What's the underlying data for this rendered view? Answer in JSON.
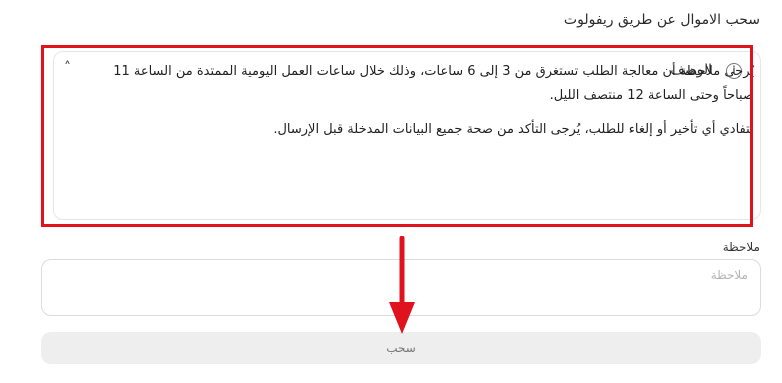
{
  "page": {
    "title": "سحب الاموال عن طريق ريفولوت"
  },
  "description_card": {
    "title": "الوصف",
    "info_icon": "info-icon",
    "toggle_icon": "chevron-up-icon",
    "paragraphs": [
      "يُرجى ملاحظة أن معالجة الطلب تستغرق من 3 إلى 6 ساعات، وذلك خلال ساعات العمل اليومية الممتدة من الساعة 11 صباحاً وحتى الساعة 12 منتصف الليل.",
      "لتفادي أي تأخير أو إلغاء للطلب، يُرجى التأكد من صحة جميع البيانات المدخلة قبل الإرسال."
    ]
  },
  "note": {
    "label": "ملاحظة",
    "placeholder": "ملاحظة",
    "value": ""
  },
  "submit": {
    "label": "سحب"
  },
  "annotation": {
    "highlight_color": "#e0121c"
  }
}
